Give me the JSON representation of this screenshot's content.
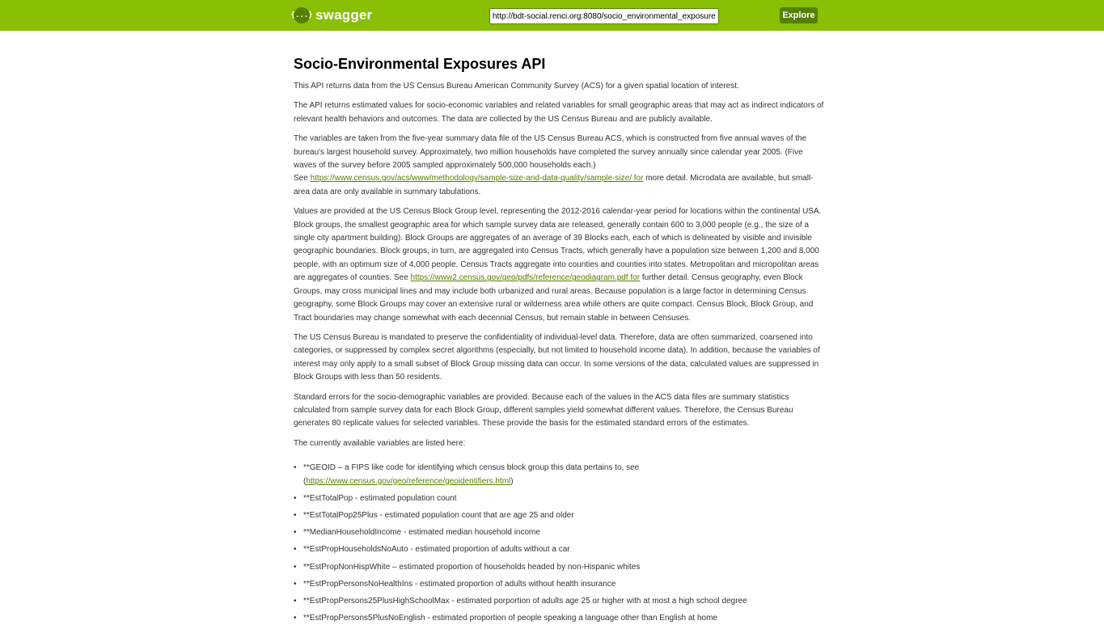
{
  "header": {
    "logo_icon": "{...}",
    "logo_text": "swagger",
    "url_value": "http://bdt-social.renci.org:8080/socio_environmental_exposures",
    "explore_label": "Explore",
    "colors": {
      "bar": "#89bf04",
      "accent": "#547f00"
    }
  },
  "main": {
    "title": "Socio-Environmental Exposures API",
    "p1": "This API returns data from the US Census Bureau American Community Survey (ACS) for a given spatial location of interest.",
    "p2": "The API returns estimated values for socio-economic variables and related variables for small geographic areas that may act as indirect indicators of relevant health behaviors and outcomes. The data are collected by the US Census Bureau and are publicly available.",
    "p3": {
      "text": "The variables are taken from the five-year summary data file of the US Census Bureau ACS, which is constructed from five annual waves of the bureau's largest household survey. Approximately, two million households have completed the survey annually since calendar year 2005. (Five waves of the survey before 2005 sampled approximately 500,000 households each.)",
      "see": "See",
      "link": "https://www.census.gov/acs/www/methodology/sample-size-and-data-quality/sample-size/ for",
      "after": " more detail. Microdata are available, but small-area data are only available in summary tabulations."
    },
    "p4": {
      "before": "Values are provided at the US Census Block Group level, representing the 2012-2016 calendar-year period for locations within the continental USA. Block groups, the smallest geographic area for which sample survey data are released, generally contain 600 to 3,000 people (e.g., the size of a single city apartment building). Block Groups are aggregates of an average of 39 Blocks each, each of which is delineated by visible and invisible geographic boundaries. Block groups, in turn, are aggregated into Census Tracts, which generally have a population size between 1,200 and 8,000 people, with an optimum size of 4,000 people. Census Tracts aggregate into counties and counties into states. Metropolitan and micropolitan areas are aggregates of counties. See ",
      "link": "https://www2.census.gov/geo/pdfs/reference/geodiagram.pdf for",
      "after": " further detail. Census geography, even Block Groups, may cross municipal lines and may include both urbanized and rural areas. Because population is a large factor in determining Census geography, some Block Groups may cover an extensive rural or wilderness area while others are quite compact. Census Block, Block Group, and Tract boundaries may change somewhat with each decennial Census, but remain stable in between Censuses."
    },
    "p5": "The US Census Bureau is mandated to preserve the confidentiality of individual-level data. Therefore, data are often summarized, coarsened into categories, or suppressed by complex secret algorithms (especially, but not limited to household income data). In addition, because the variables of interest may only apply to a small subset of Block Group missing data can occur. In some versions of the data, calculated values are suppressed in Block Groups with less than 50 residents.",
    "p6": "Standard errors for the socio-demographic variables are provided. Because each of the values in the ACS data files are summary statistics calculated from sample survey data for each Block Group, different samples yield somewhat different values. Therefore, the Census Bureau generates 80 replicate values for selected variables. These provide the basis for the estimated standard errors of the estimates.",
    "p7": "The currently available variables are listed here:",
    "variables": {
      "geoid": {
        "text": "**GEOID – a FIPS like code for identifying which census block group this data pertains to, see",
        "open": "(",
        "link": "https://www.census.gov/geo/reference/geoidentifiers.html",
        "close": ")"
      },
      "items": [
        "**EstTotalPop - estimated population count",
        "**EstTotalPop25Plus - estimated population count that are age 25 and older",
        "**MedianHouseholdIncome - estimated median household income",
        "**EstPropHouseholdsNoAuto - estimated proportion of adults without a car",
        "**EstPropNonHispWhite – estimated proportion of households headed by non-Hispanic whites",
        "**EstPropPersonsNoHealthIns - estimated proportion of adults without health insurance",
        "**EstPropPersons25PlusHighSchoolMax - estimated porportion of adults age 25 or higher with at most a high school degree",
        "**EstPropPersons5PlusNoEnglish - estimated proportion of people speaking a language other than English at home"
      ]
    }
  }
}
